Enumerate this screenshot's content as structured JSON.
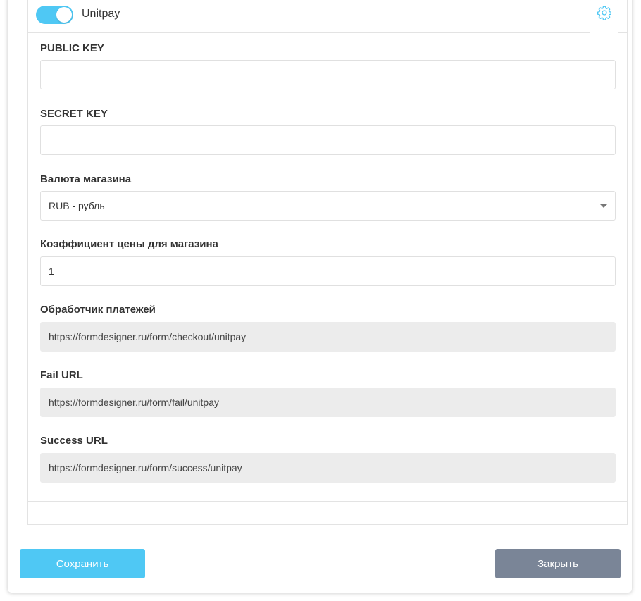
{
  "provider": {
    "name": "Unitpay",
    "enabled": true,
    "settings_icon": "gear-icon"
  },
  "fields": {
    "public_key": {
      "label": "PUBLIC KEY",
      "value": ""
    },
    "secret_key": {
      "label": "SECRET KEY",
      "value": ""
    },
    "currency": {
      "label": "Валюта магазина",
      "value": "RUB - рубль"
    },
    "price_coefficient": {
      "label": "Коэффициент цены для магазина",
      "value": "1"
    },
    "payment_handler": {
      "label": "Обработчик платежей",
      "value": "https://formdesigner.ru/form/checkout/unitpay"
    },
    "fail_url": {
      "label": "Fail URL",
      "value": "https://formdesigner.ru/form/fail/unitpay"
    },
    "success_url": {
      "label": "Success URL",
      "value": "https://formdesigner.ru/form/success/unitpay"
    }
  },
  "buttons": {
    "save": "Сохранить",
    "close": "Закрыть"
  },
  "colors": {
    "accent": "#4fc8f4",
    "close_button": "#7a8597",
    "readonly_bg": "#ececec"
  }
}
